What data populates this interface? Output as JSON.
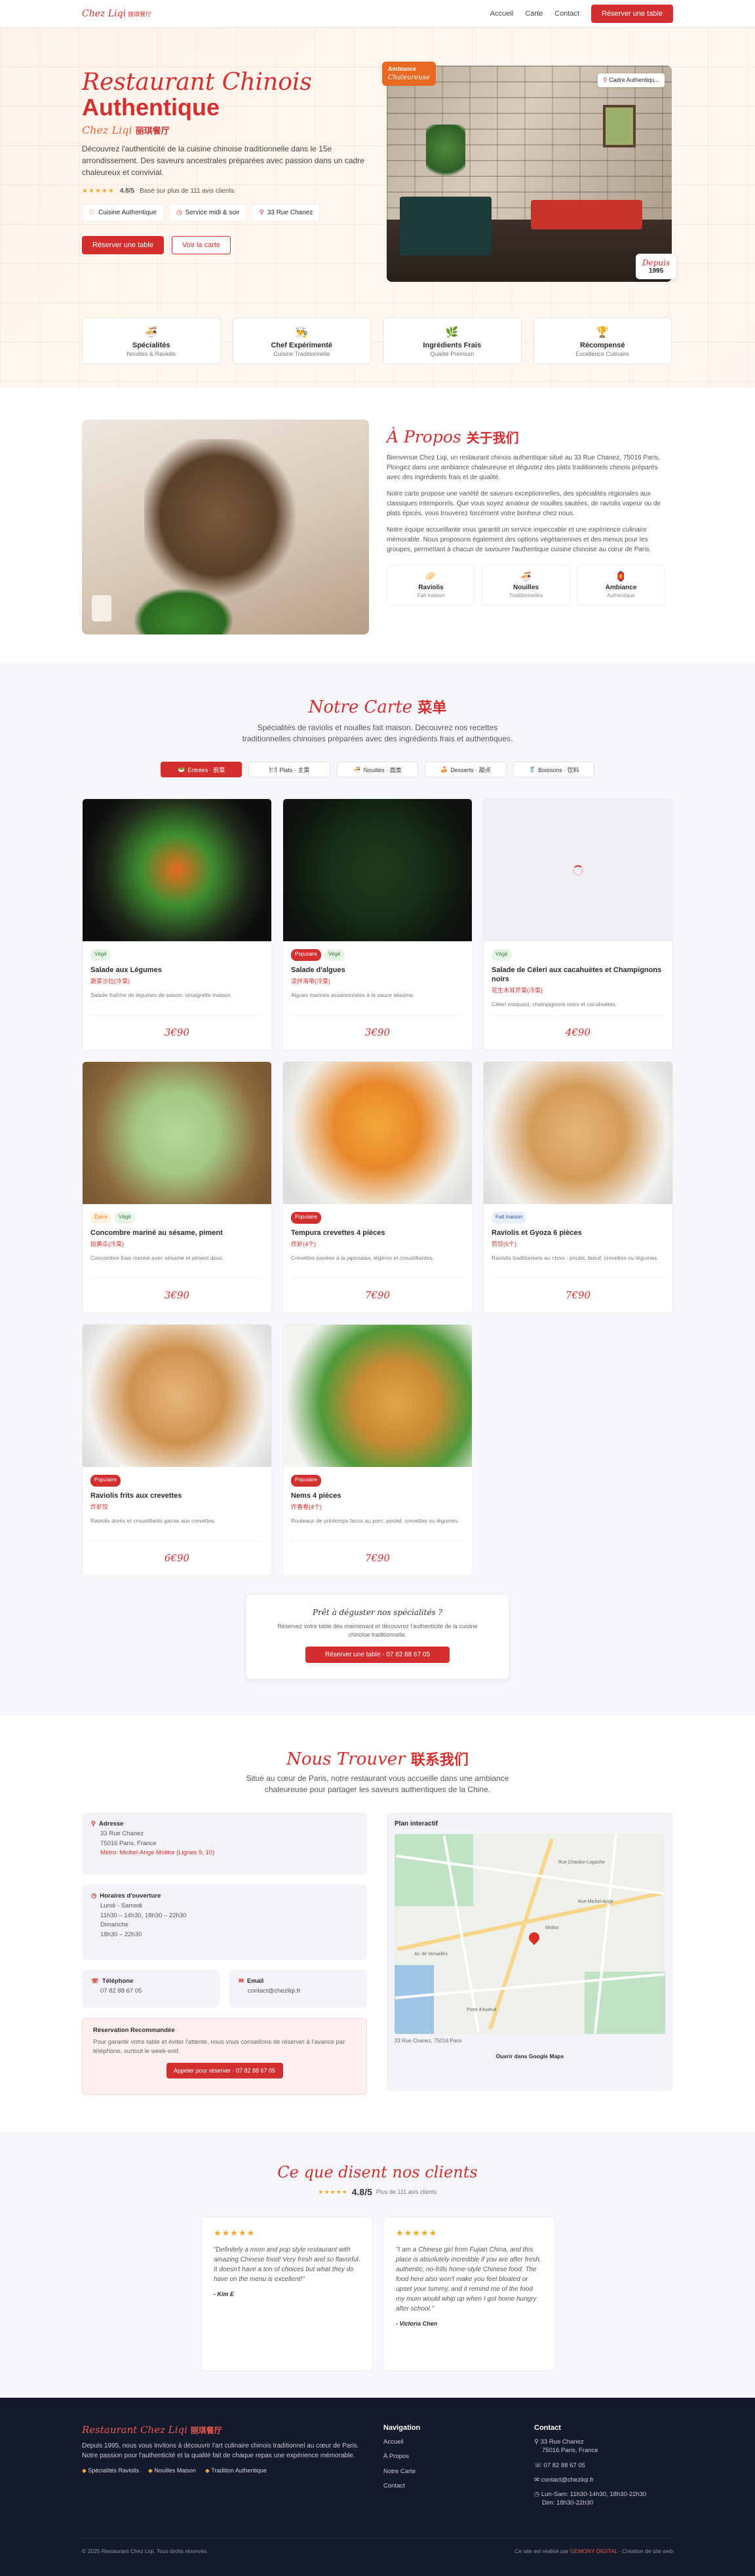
{
  "nav": {
    "logo": "Chez Liqi",
    "logo_cn": "丽琪餐厅",
    "links": [
      "Accueil",
      "Carte",
      "Contact"
    ],
    "cta": "Réserver une table"
  },
  "hero": {
    "title_line1": "Restaurant Chinois",
    "title_line2": "Authentique",
    "subtitle": "Chez Liqi",
    "subtitle_cn": "丽琪餐厅",
    "description": "Découvrez l'authenticité de la cuisine chinoise traditionnelle dans le 15e arrondissement. Des saveurs ancestrales préparées avec passion dans un cadre chaleureux et convivial.",
    "stars": "★★★★★",
    "rating": "4.8/5",
    "rating_text": "Basé sur plus de 111 avis clients",
    "chips": [
      "Cuisine Authentique",
      "Service midi & soir",
      "33 Rue Chanez"
    ],
    "btn_primary": "Réserver une table",
    "btn_secondary": "Voir la carte",
    "badge_ambiance_1": "Ambiance",
    "badge_ambiance_2": "Chaleureuse",
    "badge_address": "Cadre Authentiqu...",
    "badge_since_label": "Depuis",
    "badge_since_year": "1995",
    "features": [
      {
        "icon": "🍜",
        "title": "Spécialités",
        "sub": "Nouilles & Raviolis"
      },
      {
        "icon": "👨‍🍳",
        "title": "Chef Expérimenté",
        "sub": "Cuisine Traditionnelle"
      },
      {
        "icon": "🌿",
        "title": "Ingrédients Frais",
        "sub": "Qualité Premium"
      },
      {
        "icon": "🏆",
        "title": "Récompensé",
        "sub": "Excellence Culinaire"
      }
    ]
  },
  "about": {
    "title": "À Propos",
    "title_cn": "关于我们",
    "p1": "Bienvenue Chez Liqi, un restaurant chinois authentique situé au 33 Rue Chanez, 75016 Paris. Plongez dans une ambiance chaleureuse et dégustez des plats traditionnels chinois préparés avec des ingrédients frais et de qualité.",
    "p2": "Notre carte propose une variété de saveurs exceptionnelles, des spécialités régionales aux classiques intemporels. Que vous soyez amateur de nouilles sautées, de raviolis vapeur ou de plats épicés, vous trouverez forcément votre bonheur chez nous.",
    "p3": "Notre équipe accueillante vous garantit un service impeccable et une expérience culinaire mémorable. Nous proposons également des options végétariennes et des menus pour les groupes, permettant à chacun de savourer l'authentique cuisine chinoise au cœur de Paris.",
    "cards": [
      {
        "icon": "🥟",
        "title": "Raviolis",
        "sub": "Fait maison"
      },
      {
        "icon": "🍜",
        "title": "Nouilles",
        "sub": "Traditionnelles"
      },
      {
        "icon": "🏮",
        "title": "Ambiance",
        "sub": "Authentique"
      }
    ]
  },
  "menu": {
    "title": "Notre Carte",
    "title_cn": "菜单",
    "intro1": "Spécialités de raviolis et nouilles fait maison. Découvrez nos recettes",
    "intro2": "traditionnelles chinoises préparées avec des ingrédients frais et authentiques.",
    "tabs": [
      {
        "icon": "🥗",
        "label": "Entrées · 前菜"
      },
      {
        "icon": "🍽",
        "label": "Plats · 主菜"
      },
      {
        "icon": "🍜",
        "label": "Nouilles · 面类"
      },
      {
        "icon": "🍰",
        "label": "Desserts · 甜点"
      },
      {
        "icon": "🥤",
        "label": "Boissons · 饮料"
      }
    ],
    "cta_title": "Prêt à déguster nos spécialités ?",
    "cta_desc": "Réservez votre table dès maintenant et découvrez l'authenticité de la cuisine chinoise traditionnelle.",
    "cta_btn": "Réserver une table · 07 82 88 67 05"
  },
  "dishes": [
    {
      "tags": [
        {
          "t": "Végé",
          "k": "veg"
        }
      ],
      "name": "Salade aux Légumes",
      "cn": "蔬菜沙拉(冷菜)",
      "desc": "Salade fraîche de légumes de saison, vinaigrette maison.",
      "price": "3€90",
      "img": "veg-salad"
    },
    {
      "tags": [
        {
          "t": "Populaire",
          "k": "pop"
        },
        {
          "t": "Végé",
          "k": "veg"
        }
      ],
      "name": "Salade d'algues",
      "cn": "凉拌海带(冷菜)",
      "desc": "Algues marines assaisonnées à la sauce sésame.",
      "price": "3€90",
      "img": "seaweed"
    },
    {
      "tags": [
        {
          "t": "Végé",
          "k": "veg"
        }
      ],
      "name": "Salade de Céleri aux cacahuètes et Champignons noirs",
      "cn": "花生木耳芹菜(冷菜)",
      "desc": "Céleri croquant, champignons noirs et cacahuètes.",
      "price": "4€90",
      "img": "loading"
    },
    {
      "tags": [
        {
          "t": "Épicé",
          "k": "spicy"
        },
        {
          "t": "Végé",
          "k": "veg"
        }
      ],
      "name": "Concombre mariné au sésame, piment",
      "cn": "拍黄瓜(冷菜)",
      "desc": "Concombre frais mariné avec sésame et piment doux.",
      "price": "3€90",
      "img": "cucumber"
    },
    {
      "tags": [
        {
          "t": "Populaire",
          "k": "pop"
        }
      ],
      "name": "Tempura crevettes 4 pièces",
      "cn": "炸虾(4个)",
      "desc": "Crevettes panées à la japonaise, légères et croustillantes.",
      "price": "7€90",
      "img": "tempura"
    },
    {
      "tags": [
        {
          "t": "Fait maison",
          "k": "fav"
        }
      ],
      "name": "Raviolis et Gyoza 6 pièces",
      "cn": "煎饺(6个)",
      "desc": "Raviolis traditionnels au choix : poulet, bœuf, crevettes ou légumes.",
      "price": "7€90",
      "img": "gyoza"
    },
    {
      "tags": [
        {
          "t": "Populaire",
          "k": "pop"
        }
      ],
      "name": "Raviolis frits aux crevettes",
      "cn": "炸虾饺",
      "desc": "Raviolis dorés et croustillants garnis aux crevettes.",
      "price": "6€90",
      "img": "fried-dumplings"
    },
    {
      "tags": [
        {
          "t": "Populaire",
          "k": "pop"
        }
      ],
      "name": "Nems 4 pièces",
      "cn": "炸春卷(4个)",
      "desc": "Rouleaux de printemps farcis au porc, poulet, crevettes ou légumes.",
      "price": "7€90",
      "img": "nems"
    }
  ],
  "contact": {
    "title": "Nous Trouver",
    "title_cn": "联系我们",
    "intro1": "Situé au cœur de Paris, notre restaurant vous accueille dans une ambiance",
    "intro2": "chaleureuse pour partager les saveurs authentiques de la Chine.",
    "address_label": "Adresse",
    "address_1": "33 Rue Chanez",
    "address_2": "75016 Paris, France",
    "address_metro": "Métro: Michel-Ange Molitor (Lignes 9, 10)",
    "hours_label": "Horaires d'ouverture",
    "hours_1": "Lundi - Samedi",
    "hours_2": "11h30 – 14h30, 18h30 – 22h30",
    "hours_3": "Dimanche",
    "hours_4": "18h30 – 22h30",
    "phone_label": "Téléphone",
    "phone": "07 82 88 67 05",
    "email_label": "Email",
    "email": "contact@chezliqi.fr",
    "resa_title": "Réservation Recommandée",
    "resa_desc": "Pour garantir votre table et éviter l'attente, nous vous conseillons de réserver à l'avance par téléphone, surtout le week-end.",
    "resa_btn": "Appeler pour réserver · 07 82 88 67 05",
    "map_title": "Plan interactif",
    "map_caption": "33 Rue Chanez, 75016 Paris",
    "map_via": "Ouvrir dans Google Maps",
    "map_labels": [
      "Molitor",
      "Rue Chardon-Lagache",
      "Rue Michel-Ange",
      "Av. de Versailles",
      "Porte d'Auteuil"
    ]
  },
  "testimonials": {
    "title": "Ce que disent nos clients",
    "stars": "★★★★★",
    "rating": "4.8/5",
    "rating_text": "Plus de 111 avis clients",
    "items": [
      {
        "stars": "★★★★★",
        "quote": "\"Definitely a mom and pop style restaurant with amazing Chinese food! Very fresh and so flavorful. It doesn't have a ton of choices but what they do have on the menu is excellent!\"",
        "author": "- Kim E"
      },
      {
        "stars": "★★★★★",
        "quote": "\"I am a Chinese girl from Fujian China, and this place is absolutely incredible if you are after fresh, authentic, no-frills home-style Chinese food. The food here also won't make you feel bloated or upset your tummy, and it remind me of the food my mum would whip up when I got home hungry after school.\"",
        "author": "- Victoria Chen"
      }
    ]
  },
  "footer": {
    "brand": "Restaurant Chez Liqi",
    "brand_cn": "丽琪餐厅",
    "desc": "Depuis 1995, nous vous invitons à découvrir l'art culinaire chinois traditionnel au cœur de Paris. Notre passion pour l'authenticité et la qualité fait de chaque repas une expérience mémorable.",
    "pills": [
      "Spécialités Raviolis",
      "Nouilles Maison",
      "Tradition Authentique"
    ],
    "nav_title": "Navigation",
    "nav_links": [
      "Accueil",
      "À Propos",
      "Notre Carte",
      "Contact"
    ],
    "contact_title": "Contact",
    "contact_address": "33 Rue Chanez",
    "contact_city": "75016 Paris, France",
    "contact_phone": "07 82 88 67 05",
    "contact_email": "contact@chezliqi.fr",
    "contact_hours_1": "Lun-Sam: 11h30-14h30, 18h30-22h30",
    "contact_hours_2": "Dim: 18h30-22h30",
    "copyright": "© 2025 Restaurant Chez Liqi. Tous droits réservés.",
    "credit_pre": "Ce site est réalisé par",
    "credit_name": "GEMONY DIGITAL",
    "credit_post": "- Création de site web"
  },
  "colors": {
    "accent": "#d32f2f",
    "accent_orange": "#e86a22",
    "footer_bg": "#141a2b",
    "section_gray": "#f6f7fa"
  }
}
